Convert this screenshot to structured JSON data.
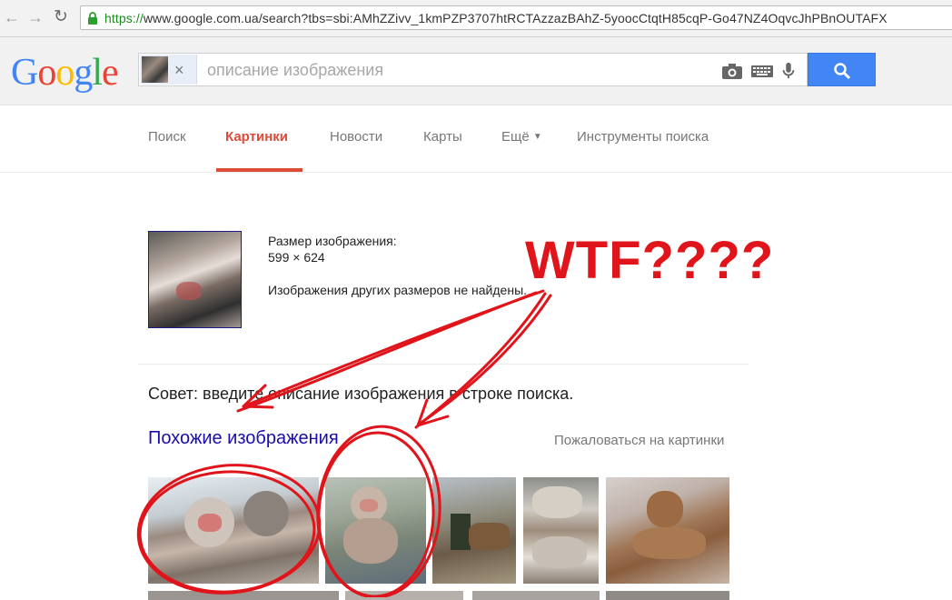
{
  "browser": {
    "url_scheme": "https://",
    "url_rest": "www.google.com.ua/search?tbs=sbi:AMhZZivv_1kmPZP3707htRCTAzzazBAhZ-5yoocCtqtH85cqP-Go47NZ4OqvcJhPBnOUTAFX"
  },
  "google": {
    "logo": "Google",
    "search_placeholder": "описание изображения"
  },
  "tabs": [
    {
      "label": "Поиск"
    },
    {
      "label": "Картинки",
      "active": true
    },
    {
      "label": "Новости"
    },
    {
      "label": "Карты"
    },
    {
      "label": "Ещё"
    },
    {
      "label": "Инструменты поиска"
    }
  ],
  "result": {
    "size_label": "Размер изображения:",
    "size_value": "599 × 624",
    "no_other_sizes": "Изображения других размеров не найдены.",
    "tip": "Совет: введите описание изображения в строке поиска.",
    "similar_title": "Похожие изображения",
    "report_link": "Пожаловаться на картинки"
  },
  "annotation": {
    "text": "WTF????",
    "color": "#e0141b"
  },
  "colors": {
    "accent": "#dd4b39",
    "link": "#1a0dab",
    "search_button": "#4285f4"
  },
  "icons": [
    "back-arrow-icon",
    "forward-arrow-icon",
    "reload-icon",
    "lock-icon",
    "camera-icon",
    "keyboard-icon",
    "microphone-icon",
    "search-icon",
    "dropdown-arrow-icon"
  ]
}
